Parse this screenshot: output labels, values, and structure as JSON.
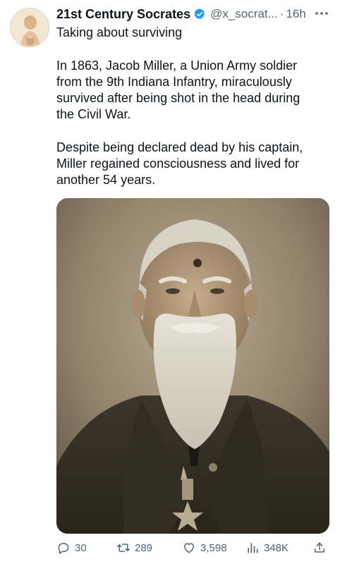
{
  "post": {
    "author_name": "21st Century Socrates",
    "handle": "@x_socrat...",
    "separator": "·",
    "time": "16h",
    "verified_color": "#1d9bf0",
    "text_line_1": "Taking about surviving",
    "paragraph_1": [
      "In 1863, Jacob Miller, a Union Army soldier",
      "from the 9th Indiana Infantry, miraculously",
      "survived after being shot in the head during",
      "the Civil War."
    ],
    "paragraph_2": [
      "Despite being declared dead by his captain,",
      "Miller regained consciousness and lived for",
      "another 54 years."
    ]
  },
  "actions": {
    "replies": "30",
    "reposts": "289",
    "likes": "3,598",
    "views": "348K"
  },
  "icons": {
    "reply": "reply-icon",
    "repost": "repost-icon",
    "like": "heart-icon",
    "views": "views-icon",
    "share": "share-icon",
    "more": "more-icon",
    "verified": "verified-badge-icon"
  }
}
